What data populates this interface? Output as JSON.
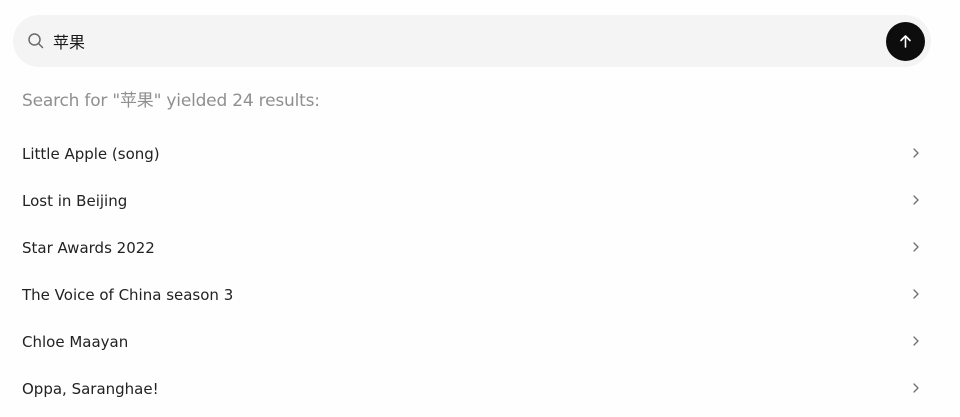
{
  "search": {
    "value": "苹果",
    "submit_label": "Submit search"
  },
  "summary_text": "Search for \"苹果\" yielded 24 results:",
  "results": [
    {
      "label": "Little Apple (song)"
    },
    {
      "label": "Lost in Beijing"
    },
    {
      "label": "Star Awards 2022"
    },
    {
      "label": "The Voice of China season 3"
    },
    {
      "label": "Chloe Maayan"
    },
    {
      "label": "Oppa, Saranghae!"
    }
  ],
  "icons": {
    "search": "search-icon",
    "submit": "arrow-up-icon",
    "row": "chevron-right-icon"
  },
  "colors": {
    "search_bg": "#f4f4f4",
    "submit_bg": "#0d0d0d",
    "summary_text": "#8f8f8f",
    "result_text": "#222222"
  }
}
